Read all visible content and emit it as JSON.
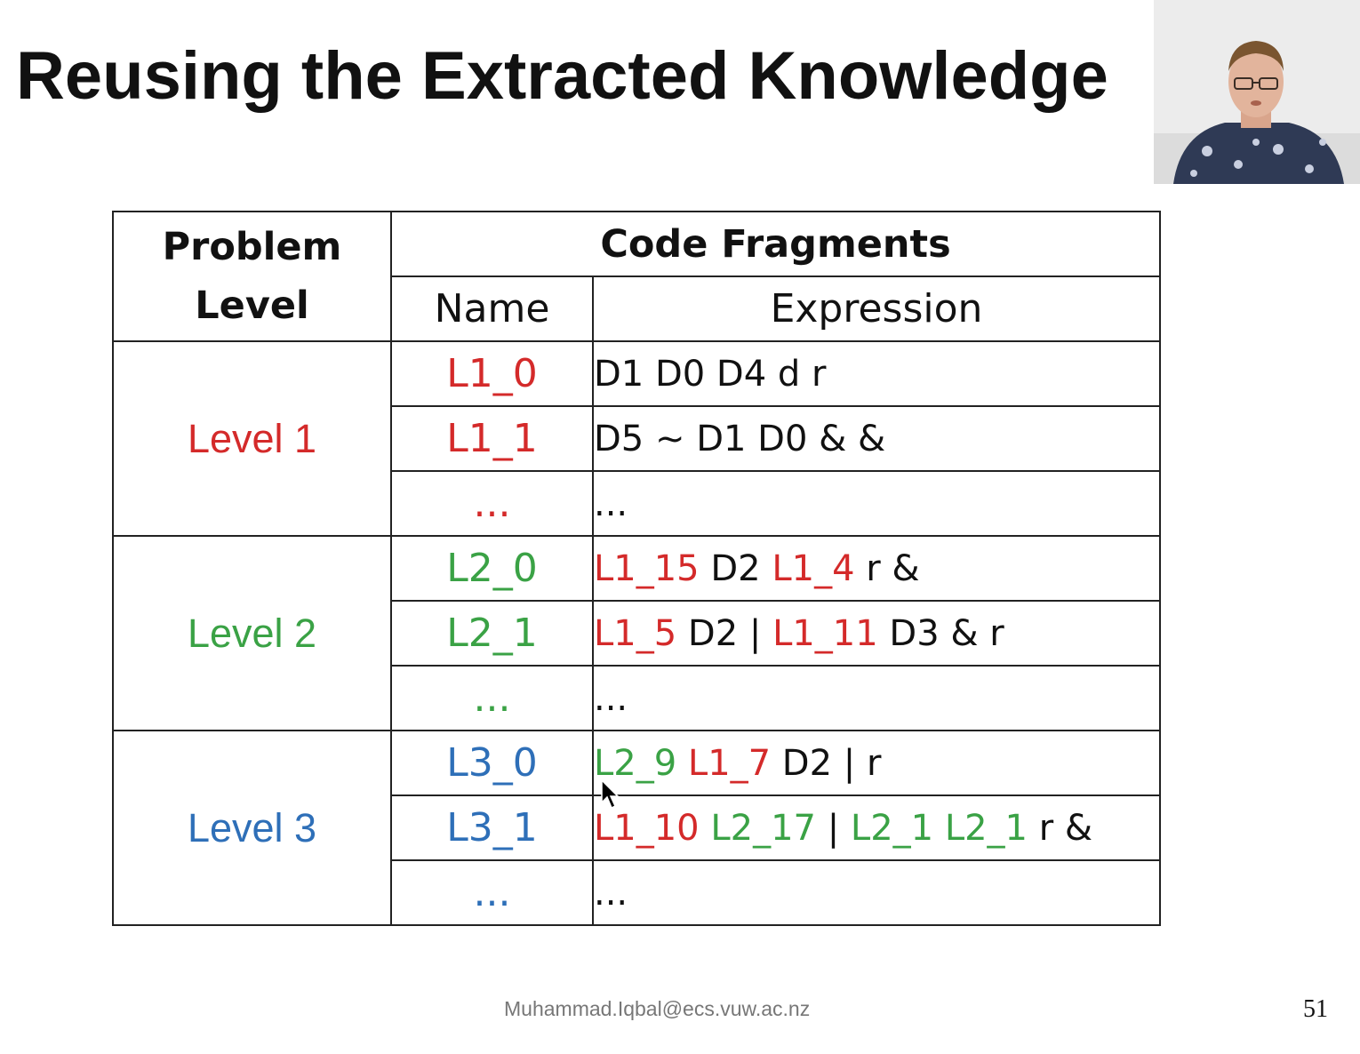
{
  "slide": {
    "title": "Reusing the Extracted Knowledge",
    "footer_email": "Muhammad.Iqbal@ecs.vuw.ac.nz",
    "page_number": "51"
  },
  "colors": {
    "level1": "#d42a2a",
    "level2": "#3aa245",
    "level3": "#2e6fb8",
    "text": "#111111"
  },
  "table": {
    "header_level_line1": "Problem",
    "header_level_line2": "Level",
    "header_fragments": "Code Fragments",
    "header_name": "Name",
    "header_expression": "Expression",
    "levels": [
      {
        "label": "Level 1",
        "color": "level1",
        "rows": [
          {
            "name": "L1_0",
            "expression": [
              {
                "text": "D1 D0 D4 d r",
                "color": "text"
              }
            ]
          },
          {
            "name": "L1_1",
            "expression": [
              {
                "text": "D5 ~ D1 D0 & &",
                "color": "text"
              }
            ]
          },
          {
            "name": "...",
            "expression": [
              {
                "text": "...",
                "color": "text"
              }
            ]
          }
        ]
      },
      {
        "label": "Level 2",
        "color": "level2",
        "rows": [
          {
            "name": "L2_0",
            "expression": [
              {
                "text": "L1_15",
                "color": "level1"
              },
              {
                "text": " D2 ",
                "color": "text"
              },
              {
                "text": "L1_4",
                "color": "level1"
              },
              {
                "text": " r &",
                "color": "text"
              }
            ]
          },
          {
            "name": "L2_1",
            "expression": [
              {
                "text": "L1_5",
                "color": "level1"
              },
              {
                "text": " D2 | ",
                "color": "text"
              },
              {
                "text": "L1_11",
                "color": "level1"
              },
              {
                "text": " D3 & r",
                "color": "text"
              }
            ]
          },
          {
            "name": "...",
            "expression": [
              {
                "text": "...",
                "color": "text"
              }
            ]
          }
        ]
      },
      {
        "label": "Level 3",
        "color": "level3",
        "rows": [
          {
            "name": "L3_0",
            "expression": [
              {
                "text": "L2_9",
                "color": "level2"
              },
              {
                "text": " ",
                "color": "text"
              },
              {
                "text": "L1_7",
                "color": "level1"
              },
              {
                "text": " D2 | r",
                "color": "text"
              }
            ]
          },
          {
            "name": "L3_1",
            "expression": [
              {
                "text": "L1_10",
                "color": "level1"
              },
              {
                "text": " ",
                "color": "text"
              },
              {
                "text": "L2_17",
                "color": "level2"
              },
              {
                "text": " | ",
                "color": "text"
              },
              {
                "text": "L2_1",
                "color": "level2"
              },
              {
                "text": " ",
                "color": "text"
              },
              {
                "text": "L2_1",
                "color": "level2"
              },
              {
                "text": " r &",
                "color": "text"
              }
            ]
          },
          {
            "name": "...",
            "expression": [
              {
                "text": "...",
                "color": "text"
              }
            ]
          }
        ]
      }
    ]
  }
}
